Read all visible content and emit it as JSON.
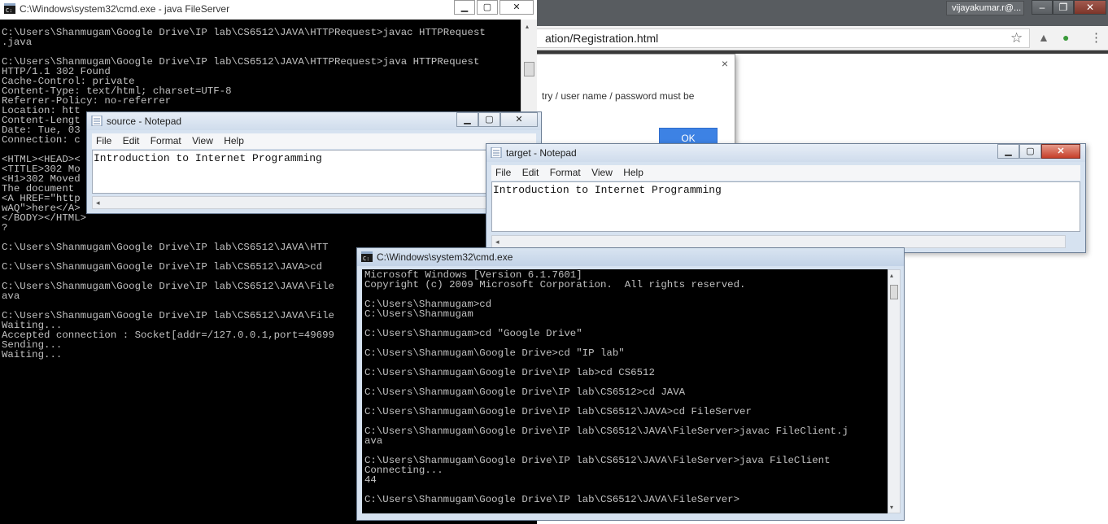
{
  "chrome": {
    "user_name": "vijayakumar.r@...",
    "omnibox_url": "ation/Registration.html",
    "alert": {
      "message": "try / user name / password must be",
      "ok_label": "OK",
      "close_glyph": "×"
    },
    "icons": {
      "star": "☆",
      "ext1": "▲",
      "ext2": "●",
      "menu": "⋮"
    },
    "controls": {
      "minimize": "‒",
      "maximize": "❐",
      "close": "✕"
    }
  },
  "cmd1": {
    "title": "C:\\Windows\\system32\\cmd.exe - java  FileServer",
    "lines": [
      "C:\\Users\\Shanmugam\\Google Drive\\IP lab\\CS6512\\JAVA\\HTTPRequest>javac HTTPRequest",
      ".java",
      "",
      "C:\\Users\\Shanmugam\\Google Drive\\IP lab\\CS6512\\JAVA\\HTTPRequest>java HTTPRequest",
      "HTTP/1.1 302 Found",
      "Cache-Control: private",
      "Content-Type: text/html; charset=UTF-8",
      "Referrer-Policy: no-referrer",
      "Location: htt",
      "Content-Lengt",
      "Date: Tue, 03",
      "Connection: c",
      "",
      "<HTML><HEAD><",
      "<TITLE>302 Mo",
      "<H1>302 Moved",
      "The document",
      "<A HREF=\"http",
      "wAQ\">here</A>",
      "</BODY></HTML>",
      "?",
      "",
      "C:\\Users\\Shanmugam\\Google Drive\\IP lab\\CS6512\\JAVA\\HTT",
      "",
      "C:\\Users\\Shanmugam\\Google Drive\\IP lab\\CS6512\\JAVA>cd",
      "",
      "C:\\Users\\Shanmugam\\Google Drive\\IP lab\\CS6512\\JAVA\\File",
      "ava",
      "",
      "C:\\Users\\Shanmugam\\Google Drive\\IP lab\\CS6512\\JAVA\\File",
      "Waiting...",
      "Accepted connection : Socket[addr=/127.0.0.1,port=49699",
      "Sending...",
      "Waiting..."
    ]
  },
  "notepad_source": {
    "title": "source - Notepad",
    "menu": [
      "File",
      "Edit",
      "Format",
      "View",
      "Help"
    ],
    "content": "Introduction to Internet Programming"
  },
  "notepad_target": {
    "title": "target - Notepad",
    "menu": [
      "File",
      "Edit",
      "Format",
      "View",
      "Help"
    ],
    "content": "Introduction to Internet Programming"
  },
  "cmd2": {
    "title": "C:\\Windows\\system32\\cmd.exe",
    "lines": [
      "Microsoft Windows [Version 6.1.7601]",
      "Copyright (c) 2009 Microsoft Corporation.  All rights reserved.",
      "",
      "C:\\Users\\Shanmugam>cd",
      "C:\\Users\\Shanmugam",
      "",
      "C:\\Users\\Shanmugam>cd \"Google Drive\"",
      "",
      "C:\\Users\\Shanmugam\\Google Drive>cd \"IP lab\"",
      "",
      "C:\\Users\\Shanmugam\\Google Drive\\IP lab>cd CS6512",
      "",
      "C:\\Users\\Shanmugam\\Google Drive\\IP lab\\CS6512>cd JAVA",
      "",
      "C:\\Users\\Shanmugam\\Google Drive\\IP lab\\CS6512\\JAVA>cd FileServer",
      "",
      "C:\\Users\\Shanmugam\\Google Drive\\IP lab\\CS6512\\JAVA\\FileServer>javac FileClient.j",
      "ava",
      "",
      "C:\\Users\\Shanmugam\\Google Drive\\IP lab\\CS6512\\JAVA\\FileServer>java FileClient",
      "Connecting...",
      "44",
      "",
      "C:\\Users\\Shanmugam\\Google Drive\\IP lab\\CS6512\\JAVA\\FileServer>"
    ]
  },
  "window_controls": {
    "minimize": "▁",
    "maximize": "▢",
    "close": "✕"
  },
  "scroll": {
    "left": "◂",
    "right": "▸",
    "up": "▴",
    "down": "▾"
  }
}
